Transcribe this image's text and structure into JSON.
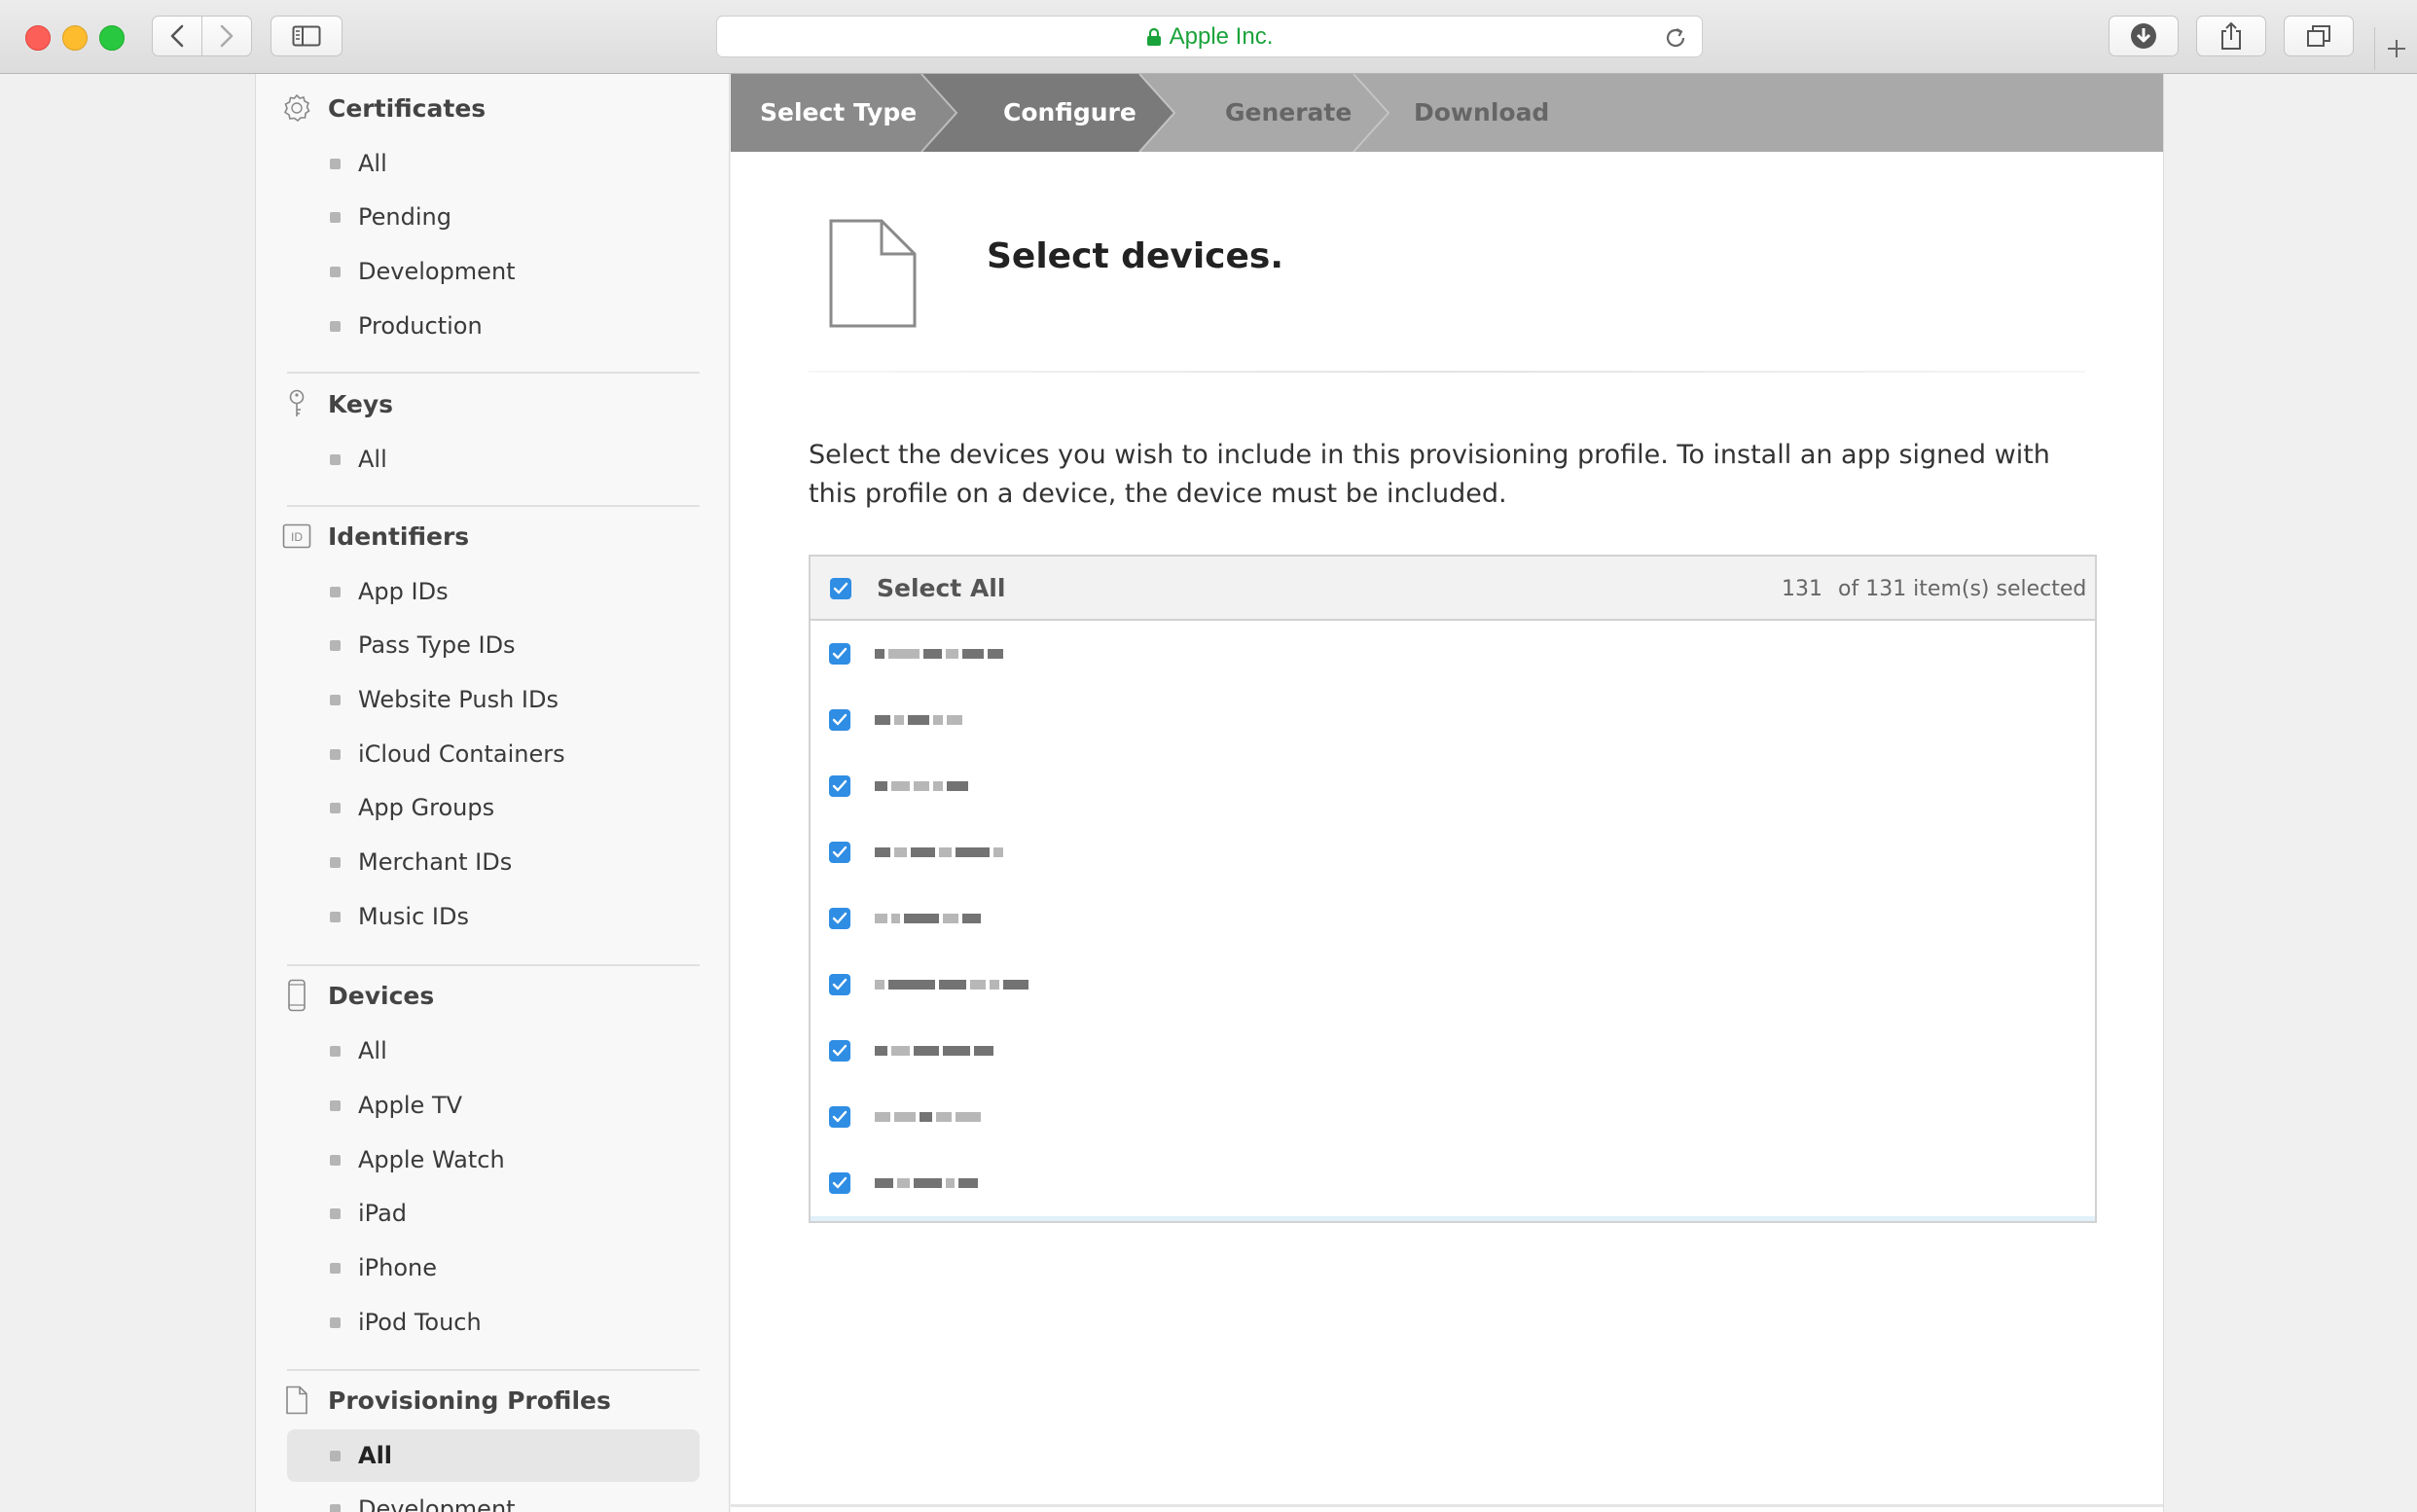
{
  "browser": {
    "url_label": "Apple Inc.",
    "buttons": [
      "back",
      "forward",
      "sidebar",
      "reload",
      "download",
      "share",
      "tabs",
      "new-tab"
    ]
  },
  "sidebar": {
    "certificates": {
      "title": "Certificates",
      "icon": "certificate-badge-icon",
      "items": [
        "All",
        "Pending",
        "Development",
        "Production"
      ]
    },
    "keys": {
      "title": "Keys",
      "icon": "key-icon",
      "items": [
        "All"
      ]
    },
    "identifiers": {
      "title": "Identifiers",
      "icon": "id-icon",
      "items": [
        "App IDs",
        "Pass Type IDs",
        "Website Push IDs",
        "iCloud Containers",
        "App Groups",
        "Merchant IDs",
        "Music IDs"
      ]
    },
    "devices": {
      "title": "Devices",
      "icon": "phone-icon",
      "items": [
        "All",
        "Apple TV",
        "Apple Watch",
        "iPad",
        "iPhone",
        "iPod Touch"
      ]
    },
    "profiles": {
      "title": "Provisioning Profiles",
      "icon": "document-icon",
      "items": [
        "All",
        "Development"
      ],
      "active": "All"
    }
  },
  "steps": [
    "Select Type",
    "Configure",
    "Generate",
    "Download"
  ],
  "current_step": "Configure",
  "main": {
    "title": "Select devices.",
    "intro": "Select the devices you wish to include in this provisioning profile. To install an app signed with this profile on a device, the device must be included."
  },
  "device_table": {
    "select_all_label": "Select All",
    "selected_count": "131",
    "count_suffix": "of 131 item(s) selected",
    "visible_rows": 10,
    "rows_checked": true,
    "row_names_redacted": true,
    "highlighted_row": 10
  },
  "colors": {
    "accent": "#2f8de4",
    "url_green": "#1aa33b",
    "row_highlight": "#e2f0fa",
    "step_active": "#8a8a8a",
    "step_bar": "#a9a9a9"
  }
}
